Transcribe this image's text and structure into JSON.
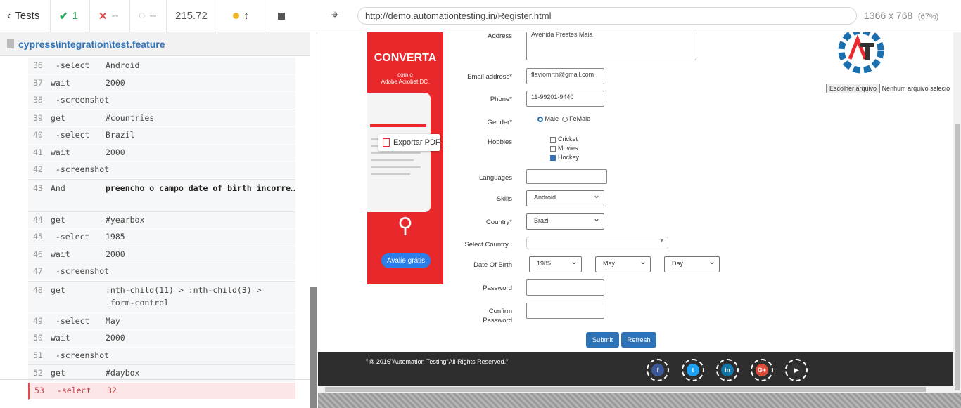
{
  "stats": {
    "tests_label": "Tests",
    "passed": "1",
    "failed": "--",
    "pending": "--",
    "duration": "215.72"
  },
  "spec": {
    "path": "cypress\\integration\\test.feature"
  },
  "commands": [
    {
      "ln": "36",
      "cmd": " -select",
      "arg": "Android"
    },
    {
      "ln": "37",
      "cmd": "wait",
      "arg": "2000"
    },
    {
      "ln": "38",
      "cmd": " -screenshot",
      "arg": ""
    },
    {
      "ln": "39",
      "cmd": "get",
      "arg": "#countries"
    },
    {
      "ln": "40",
      "cmd": " -select",
      "arg": "Brazil"
    },
    {
      "ln": "41",
      "cmd": "wait",
      "arg": "2000"
    },
    {
      "ln": "42",
      "cmd": " -screenshot",
      "arg": ""
    },
    {
      "ln": "43",
      "cmd": "And",
      "arg": "preencho o campo date of birth incorre…"
    },
    {
      "ln": "44",
      "cmd": "get",
      "arg": "#yearbox"
    },
    {
      "ln": "45",
      "cmd": " -select",
      "arg": "1985"
    },
    {
      "ln": "46",
      "cmd": "wait",
      "arg": "2000"
    },
    {
      "ln": "47",
      "cmd": " -screenshot",
      "arg": ""
    },
    {
      "ln": "48",
      "cmd": "get",
      "arg": ":nth-child(11) > :nth-child(3) > .form-control"
    },
    {
      "ln": "49",
      "cmd": " -select",
      "arg": "May"
    },
    {
      "ln": "50",
      "cmd": "wait",
      "arg": "2000"
    },
    {
      "ln": "51",
      "cmd": " -screenshot",
      "arg": ""
    },
    {
      "ln": "52",
      "cmd": "get",
      "arg": "#daybox"
    },
    {
      "ln": "53",
      "cmd": " -select",
      "arg": "32"
    }
  ],
  "browser": {
    "url": "http://demo.automationtesting.in/Register.html",
    "viewport": "1366 x 768",
    "zoom": "(67%)"
  },
  "form": {
    "address_label": "Address",
    "address_value": "Avenida Prestes Maia",
    "email_label": "Email address*",
    "email_value": "flaviomrtn@gmail.com",
    "phone_label": "Phone*",
    "phone_value": "11-99201-9440",
    "gender_label": "Gender*",
    "gender_male": "Male",
    "gender_female": "FeMale",
    "hobbies_label": "Hobbies",
    "hobby_1": "Cricket",
    "hobby_2": "Movies",
    "hobby_3": "Hockey",
    "languages_label": "Languages",
    "skills_label": "Skills",
    "skills_value": "Android",
    "country_label": "Country*",
    "country_value": "Brazil",
    "select_country_label": "Select Country :",
    "dob_label": "Date Of Birth",
    "dob_year": "1985",
    "dob_month": "May",
    "dob_day": "Day",
    "password_label": "Password",
    "confirm_label_1": "Confirm",
    "confirm_label_2": "Password",
    "submit": "Submit",
    "refresh": "Refresh",
    "file_button": "Escolher arquivo",
    "file_status": "Nenhum arquivo selecio"
  },
  "ad": {
    "headline": "CONVERTA",
    "sub1": "com o",
    "sub2": "Adobe Acrobat DC.",
    "export": "Exportar PDF",
    "cta": "Avalie grátis"
  },
  "footer": {
    "copyright": "\"@ 2016\"Automation Testing\"All Rights Reserved.\""
  },
  "colors": {
    "pass": "#26a65b",
    "fail": "#e5484d",
    "primary": "#2f73b6"
  }
}
